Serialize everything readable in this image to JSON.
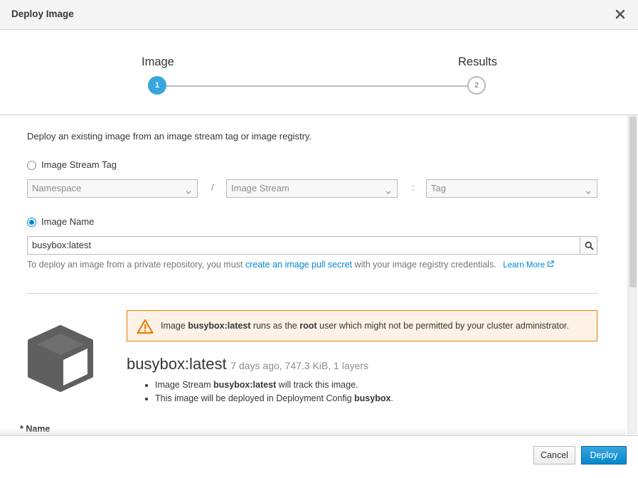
{
  "dialog": {
    "title": "Deploy Image"
  },
  "wizard": {
    "steps": [
      {
        "label": "Image",
        "number": "1",
        "active": true
      },
      {
        "label": "Results",
        "number": "2",
        "active": false
      }
    ]
  },
  "form": {
    "intro": "Deploy an existing image from an image stream tag or image registry.",
    "image_stream_tag": {
      "label": "Image Stream Tag",
      "namespace_placeholder": "Namespace",
      "image_stream_placeholder": "Image Stream",
      "tag_placeholder": "Tag",
      "separator_slash": "/",
      "separator_colon": ":"
    },
    "image_name": {
      "label": "Image Name",
      "value": "busybox:latest"
    },
    "help": {
      "prefix": "To deploy an image from a private repository, you must ",
      "link": "create an image pull secret",
      "suffix": " with your image registry credentials.",
      "learn_more": "Learn More"
    }
  },
  "warning": {
    "pre": "Image ",
    "image": "busybox:latest",
    "mid": " runs as the ",
    "user": "root",
    "post": " user which might not be permitted by your cluster administrator."
  },
  "image_info": {
    "name": "busybox:latest",
    "meta": "7 days ago, 747.3 KiB, 1 layers",
    "bullet1_pre": "Image Stream ",
    "bullet1_bold": "busybox:latest",
    "bullet1_post": " will track this image.",
    "bullet2_pre": "This image will be deployed in Deployment Config ",
    "bullet2_bold": "busybox",
    "bullet2_post": "."
  },
  "name_field": {
    "label": "* Name"
  },
  "footer": {
    "cancel": "Cancel",
    "deploy": "Deploy"
  },
  "icons": {
    "close": "close-icon",
    "search": "search-icon",
    "warning": "warning-triangle-icon",
    "cube": "cube-icon",
    "external": "external-link-icon",
    "caret": "chevron-down-icon"
  },
  "colors": {
    "primary": "#0088ce",
    "active_step": "#39a5dc",
    "warning_border": "#ec7a08",
    "warning_bg": "#fdf2e5"
  }
}
